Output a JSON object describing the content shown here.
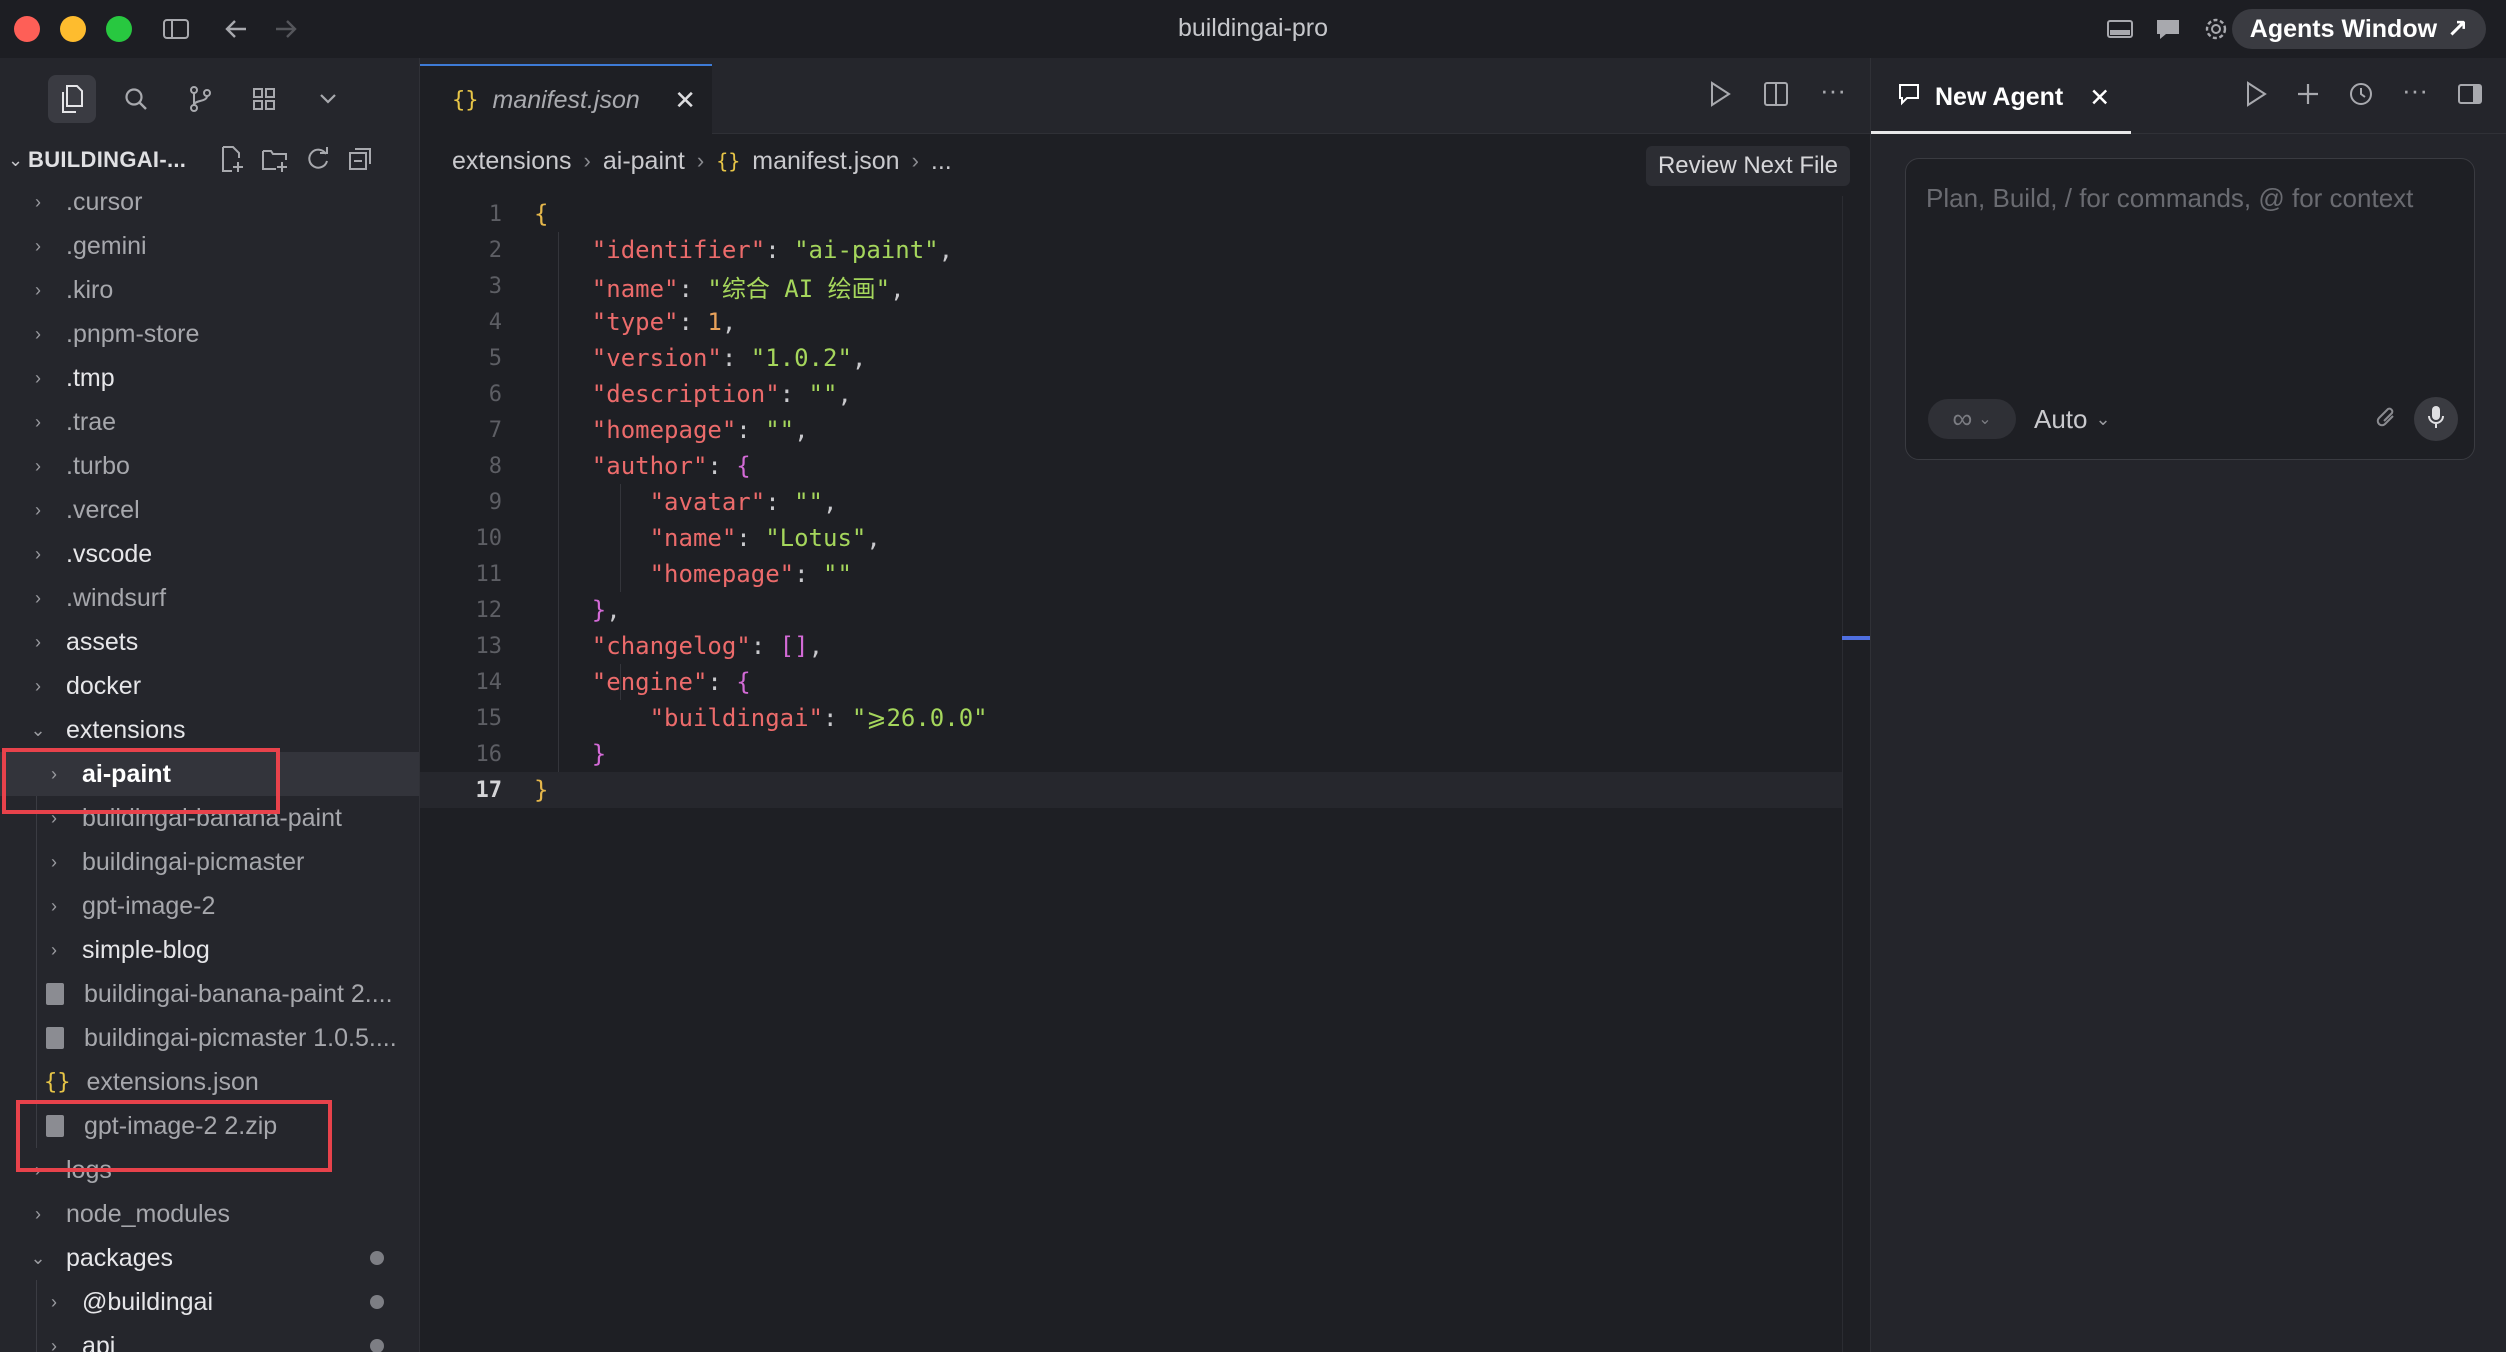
{
  "window": {
    "title": "buildingai-pro",
    "agents_button": "Agents Window"
  },
  "explorer": {
    "root": "BUILDINGAI-...",
    "items": [
      {
        "label": ".cursor"
      },
      {
        "label": ".gemini"
      },
      {
        "label": ".kiro"
      },
      {
        "label": ".pnpm-store"
      },
      {
        "label": ".tmp"
      },
      {
        "label": ".trae"
      },
      {
        "label": ".turbo"
      },
      {
        "label": ".vercel"
      },
      {
        "label": ".vscode"
      },
      {
        "label": ".windsurf"
      },
      {
        "label": "assets"
      },
      {
        "label": "docker"
      },
      {
        "label": "extensions"
      },
      {
        "label": "ai-paint"
      },
      {
        "label": "buildingai-banana-paint"
      },
      {
        "label": "buildingai-picmaster"
      },
      {
        "label": "gpt-image-2"
      },
      {
        "label": "simple-blog"
      },
      {
        "label": "buildingai-banana-paint 2...."
      },
      {
        "label": "buildingai-picmaster 1.0.5...."
      },
      {
        "label": "extensions.json"
      },
      {
        "label": "gpt-image-2 2.zip"
      },
      {
        "label": "logs"
      },
      {
        "label": "node_modules"
      },
      {
        "label": "packages"
      },
      {
        "label": "@buildingai"
      },
      {
        "label": "api"
      }
    ]
  },
  "editor": {
    "tab_label": "manifest.json",
    "breadcrumb": [
      "extensions",
      "ai-paint",
      "manifest.json",
      "..."
    ],
    "review_button": "Review Next File",
    "line_numbers": [
      "1",
      "2",
      "3",
      "4",
      "5",
      "6",
      "7",
      "8",
      "9",
      "10",
      "11",
      "12",
      "13",
      "14",
      "15",
      "16",
      "17"
    ],
    "code": {
      "k_identifier": "\"identifier\"",
      "v_identifier": "\"ai-paint\"",
      "k_name": "\"name\"",
      "v_name": "\"综合 AI 绘画\"",
      "k_type": "\"type\"",
      "v_type": "1",
      "k_version": "\"version\"",
      "v_version": "\"1.0.2\"",
      "k_description": "\"description\"",
      "v_description": "\"\"",
      "k_homepage": "\"homepage\"",
      "v_homepage": "\"\"",
      "k_author": "\"author\"",
      "k_avatar": "\"avatar\"",
      "v_avatar": "\"\"",
      "k_author_name": "\"name\"",
      "v_author_name": "\"Lotus\"",
      "k_author_homepage": "\"homepage\"",
      "v_author_homepage": "\"\"",
      "k_changelog": "\"changelog\"",
      "v_changelog": "[]",
      "k_engine": "\"engine\"",
      "k_buildingai": "\"buildingai\"",
      "v_buildingai": "\"⩾26.0.0\""
    }
  },
  "agent": {
    "tab_label": "New Agent",
    "input_placeholder": "Plan, Build, / for commands, @ for context",
    "model": "Auto",
    "mode_icon": "infinity-icon"
  }
}
